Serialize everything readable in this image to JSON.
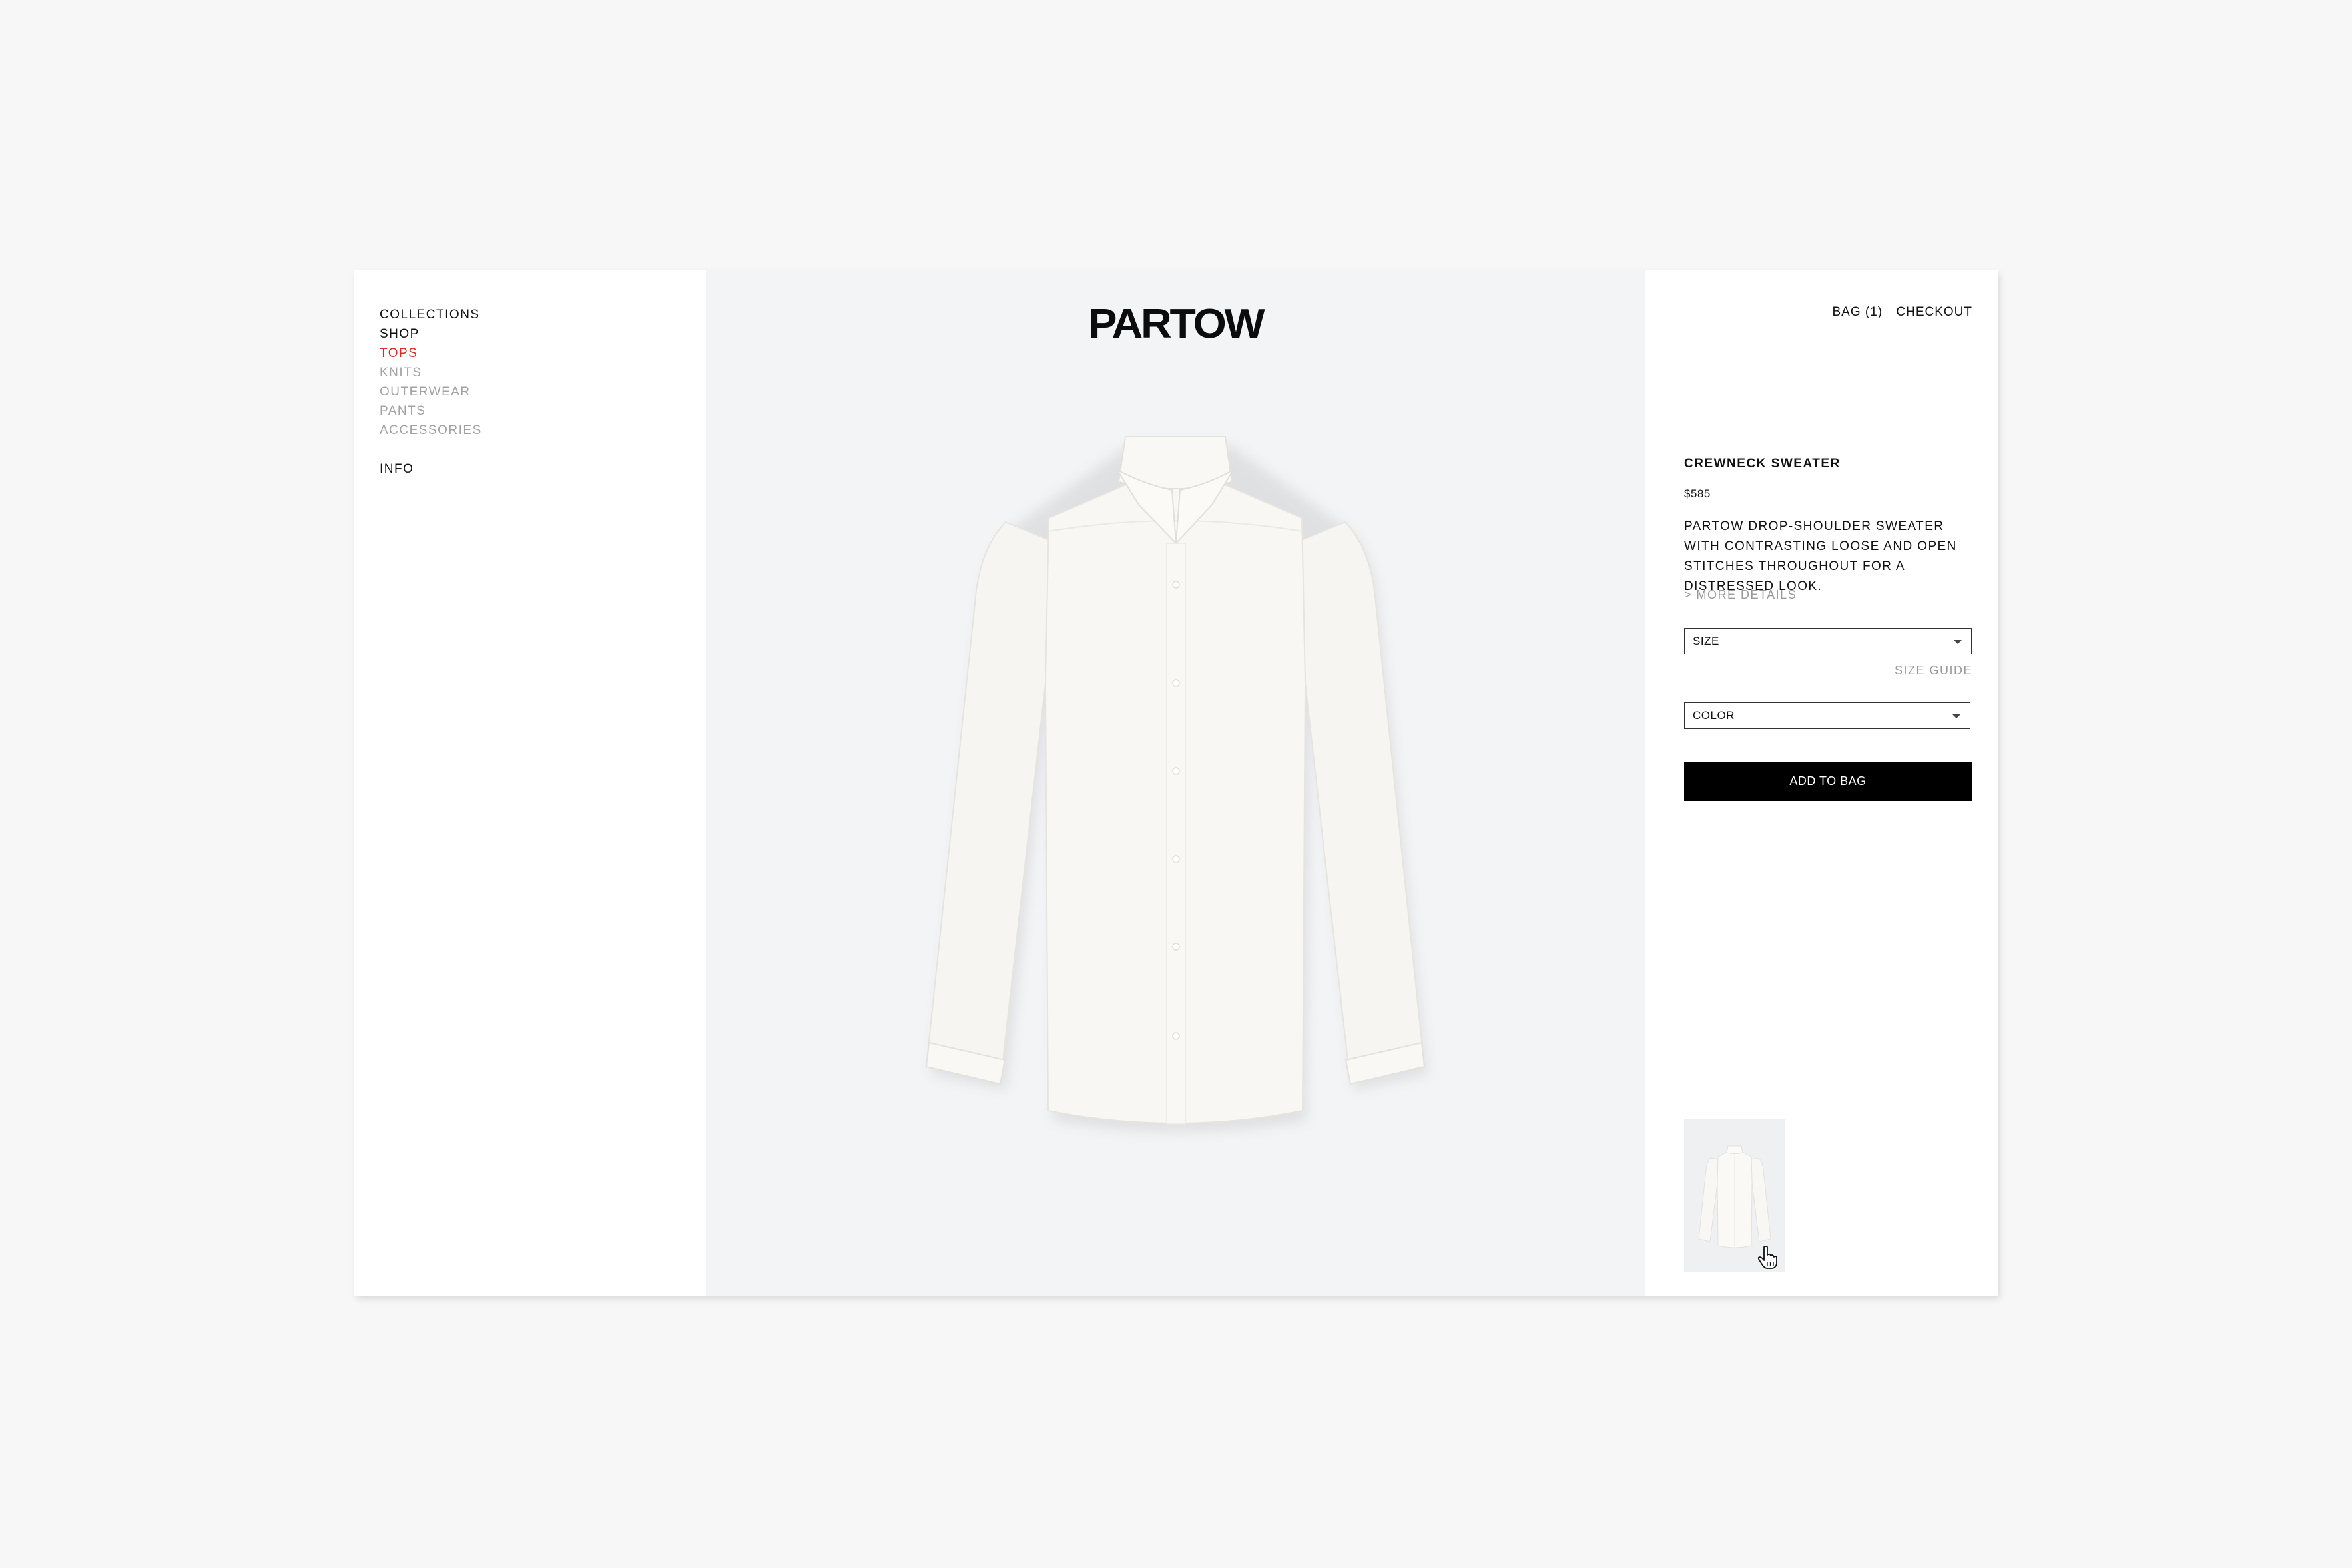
{
  "brand": {
    "logo": "PARTOW"
  },
  "nav": {
    "collections": "COLLECTIONS",
    "shop": "SHOP",
    "categories": [
      "TOPS",
      "KNITS",
      "OUTERWEAR",
      "PANTS",
      "ACCESSORIES"
    ],
    "active_category": "TOPS",
    "info": "INFO"
  },
  "header": {
    "bag": "BAG (1)",
    "checkout": "CHECKOUT"
  },
  "product": {
    "name": "CREWNECK SWEATER",
    "price": "$585",
    "description": "PARTOW DROP-SHOULDER SWEATER WITH CONTRASTING LOOSE AND OPEN STITCHES THROUGHOUT FOR A DISTRESSED LOOK.",
    "more_details": "> MORE DETAILS",
    "size_select": "SIZE",
    "size_guide": "SIZE GUIDE",
    "color_select": "COLOR",
    "add_to_bag": "ADD TO BAG"
  },
  "colors": {
    "page_bg": "#f7f7f7",
    "stage_bg": "#f3f4f6",
    "accent_active": "#d62b2b",
    "muted_text": "#a3a3a3",
    "button_bg": "#000000"
  },
  "icons": {
    "select_caret": "caret-down-icon",
    "cursor": "hand-pointer-icon"
  }
}
